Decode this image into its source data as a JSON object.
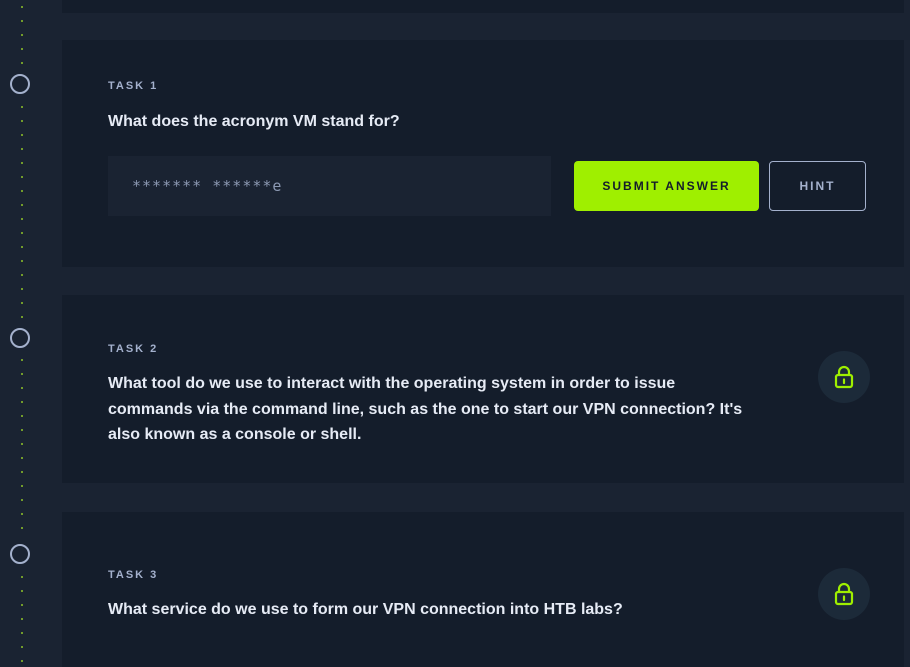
{
  "tasks": [
    {
      "label": "TASK 1",
      "question": "What does the acronym VM stand for?",
      "answer_mask": "*******  ******e",
      "submit_label": "SUBMIT ANSWER",
      "hint_label": "HINT"
    },
    {
      "label": "TASK 2",
      "question": "What tool do we use to interact with the operating system in order to issue commands via the command line, such as the one to start our VPN connection? It's also known as a console or shell.",
      "locked": true
    },
    {
      "label": "TASK 3",
      "question": "What service do we use to form our VPN connection into HTB labs?",
      "locked": true
    }
  ],
  "colors": {
    "accent": "#9fef00",
    "card_bg": "#141d2b",
    "page_bg": "#1a2332",
    "muted_text": "#a4b1cd",
    "primary_text": "#e6ebf5"
  },
  "icons": {
    "lock": "lock-icon",
    "timeline": "circle-icon"
  }
}
